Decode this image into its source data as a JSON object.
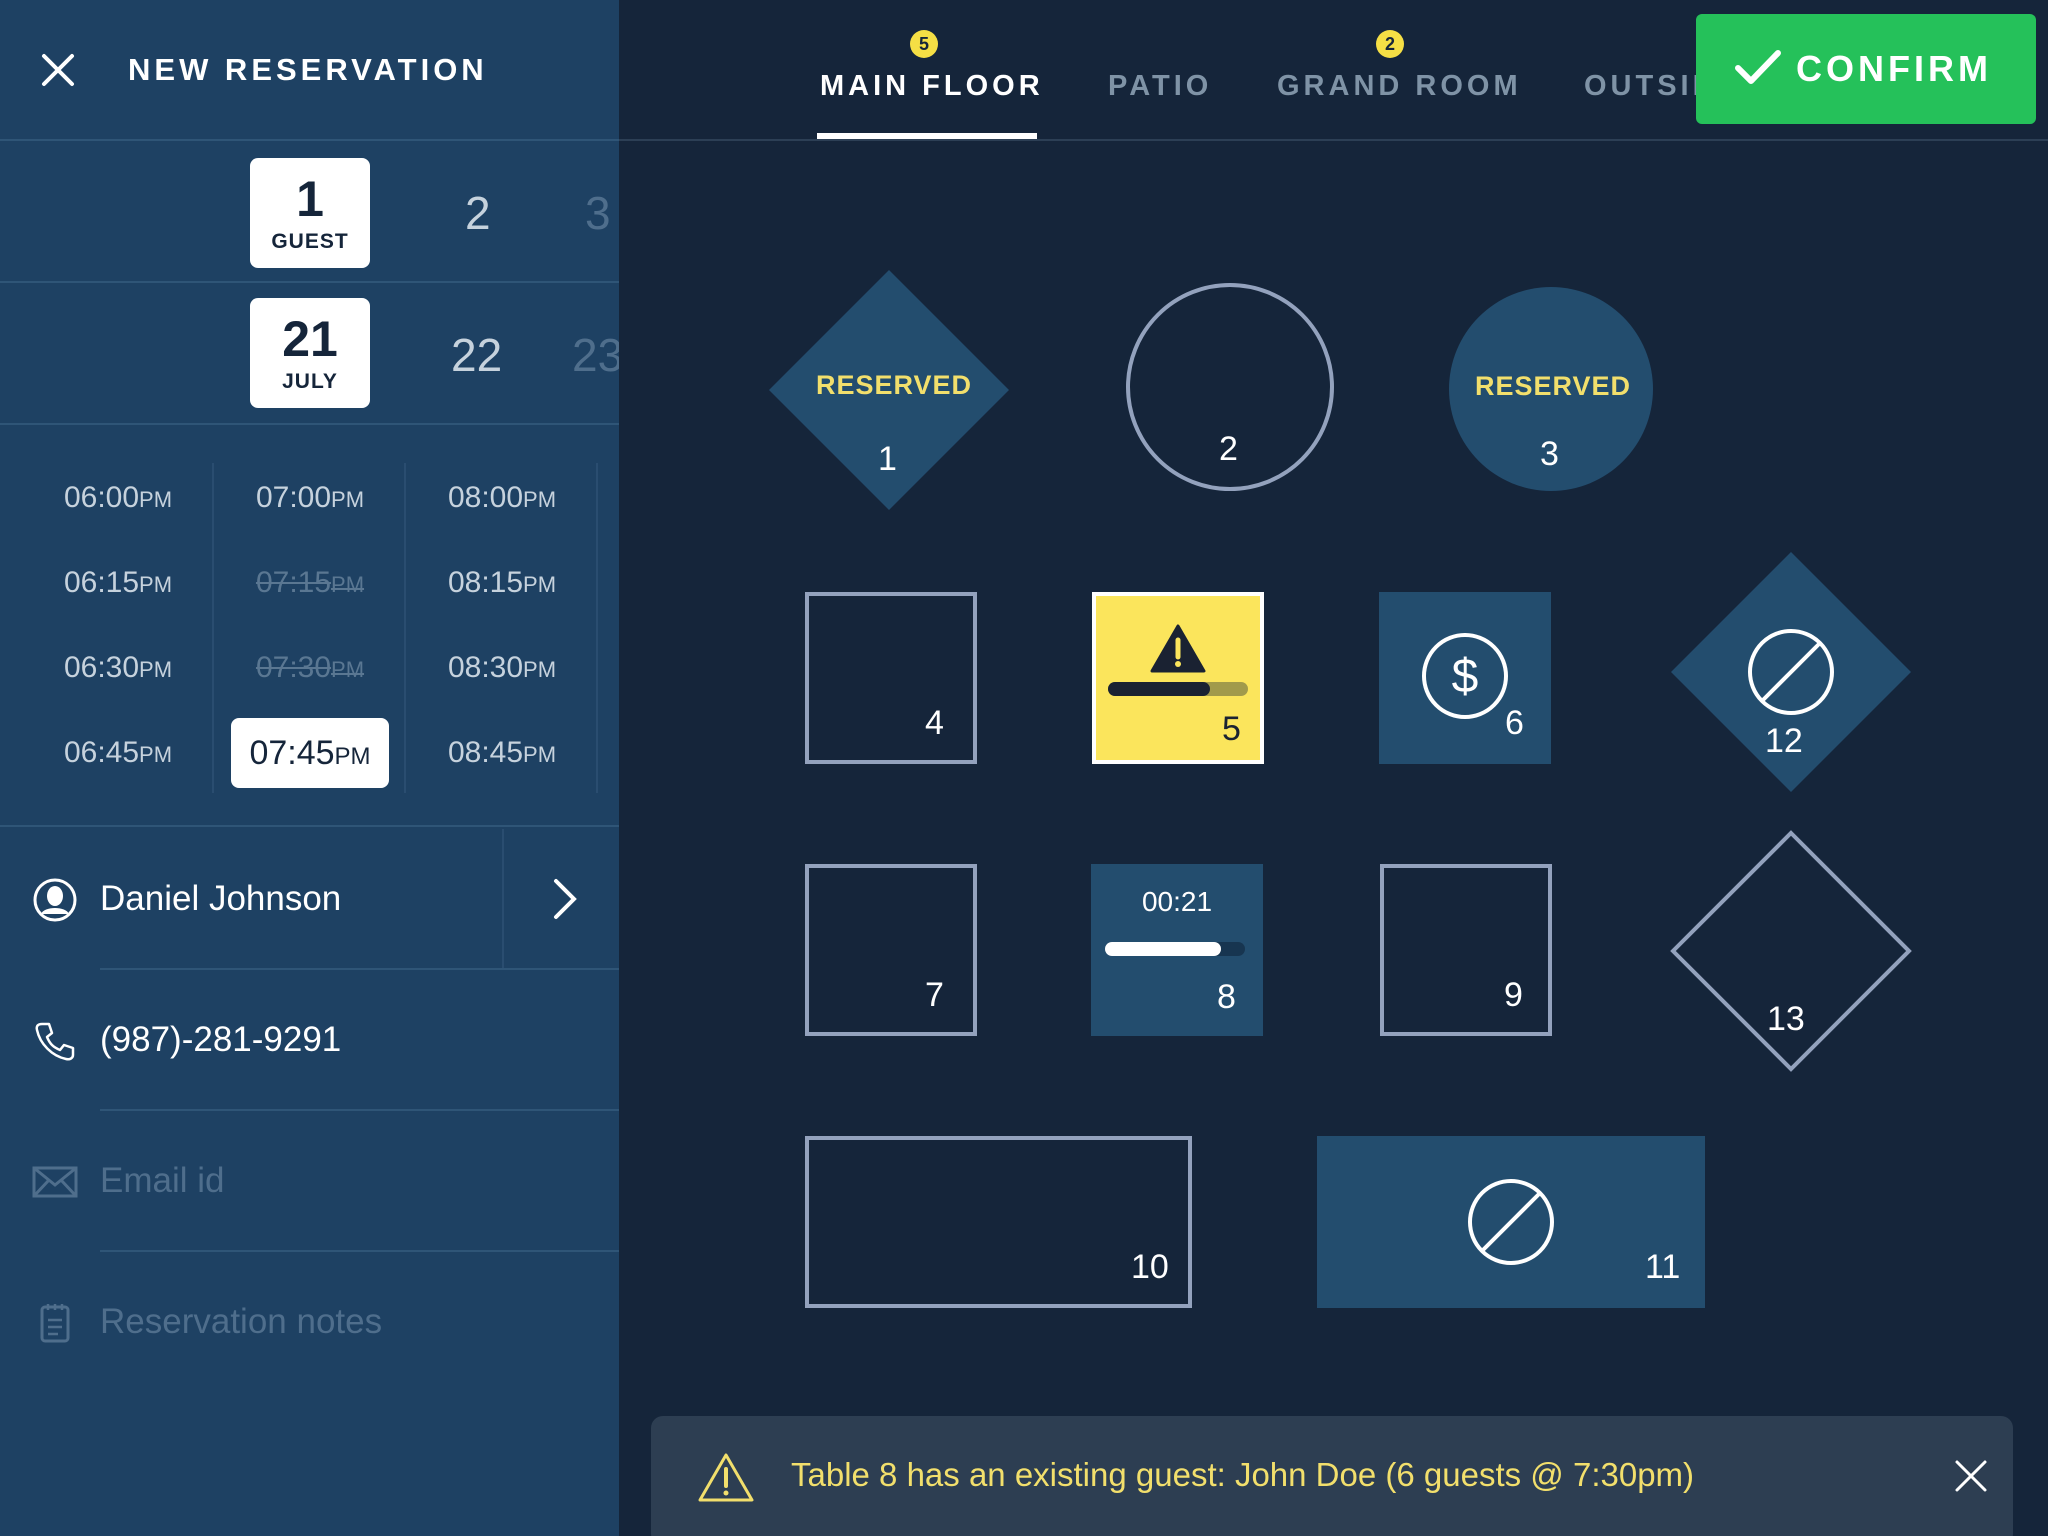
{
  "header": {
    "title": "NEW RESERVATION"
  },
  "guests": {
    "selected": {
      "value": "1",
      "unit": "GUEST"
    },
    "options": [
      "2",
      "3"
    ]
  },
  "date": {
    "selected": {
      "day": "21",
      "month": "JULY"
    },
    "options": [
      "22",
      "23"
    ]
  },
  "times": {
    "columns": [
      [
        {
          "t": "06:00",
          "p": "PM"
        },
        {
          "t": "06:15",
          "p": "PM"
        },
        {
          "t": "06:30",
          "p": "PM"
        },
        {
          "t": "06:45",
          "p": "PM"
        }
      ],
      [
        {
          "t": "07:00",
          "p": "PM"
        },
        {
          "t": "07:15",
          "p": "PM",
          "unavailable": true
        },
        {
          "t": "07:30",
          "p": "PM",
          "unavailable": true
        },
        {
          "t": "07:45",
          "p": "PM",
          "selected": true
        }
      ],
      [
        {
          "t": "08:00",
          "p": "PM"
        },
        {
          "t": "08:15",
          "p": "PM"
        },
        {
          "t": "08:30",
          "p": "PM"
        },
        {
          "t": "08:45",
          "p": "PM"
        }
      ]
    ]
  },
  "guest": {
    "name": "Daniel Johnson",
    "phone": "(987)-281-9291",
    "email_placeholder": "Email id",
    "notes_placeholder": "Reservation notes"
  },
  "tabs": [
    {
      "label": "MAIN FLOOR",
      "badge": "5",
      "active": true
    },
    {
      "label": "PATIO"
    },
    {
      "label": "GRAND ROOM",
      "badge": "2"
    },
    {
      "label": "OUTSIDE"
    }
  ],
  "confirm": {
    "label": "CONFIRM"
  },
  "tables": [
    {
      "number": "1",
      "shape": "diamond",
      "state": "reserved",
      "label": "RESERVED"
    },
    {
      "number": "2",
      "shape": "circle",
      "state": "available"
    },
    {
      "number": "3",
      "shape": "circle",
      "state": "reserved",
      "label": "RESERVED"
    },
    {
      "number": "4",
      "shape": "square",
      "state": "available"
    },
    {
      "number": "5",
      "shape": "square",
      "state": "warning",
      "icon": "warning-icon",
      "progress": 0.73
    },
    {
      "number": "6",
      "shape": "square",
      "state": "paid",
      "icon": "dollar-icon"
    },
    {
      "number": "7",
      "shape": "square",
      "state": "available"
    },
    {
      "number": "8",
      "shape": "square",
      "state": "seated",
      "timer": "00:21",
      "progress": 0.83
    },
    {
      "number": "9",
      "shape": "square",
      "state": "available"
    },
    {
      "number": "10",
      "shape": "rectangle",
      "state": "available"
    },
    {
      "number": "11",
      "shape": "rectangle",
      "state": "blocked",
      "icon": "blocked-icon"
    },
    {
      "number": "12",
      "shape": "diamond",
      "state": "blocked",
      "icon": "blocked-icon"
    },
    {
      "number": "13",
      "shape": "diamond",
      "state": "available"
    }
  ],
  "alert": {
    "message": "Table 8 has an existing guest: John Doe (6 guests @ 7:30pm)"
  },
  "colors": {
    "sidebar": "#1e4163",
    "floor": "#15253a",
    "table_fill": "#234d6e",
    "table_outline": "#93a2bd",
    "accent_yellow": "#f5df45",
    "confirm_green": "#25c15a"
  }
}
